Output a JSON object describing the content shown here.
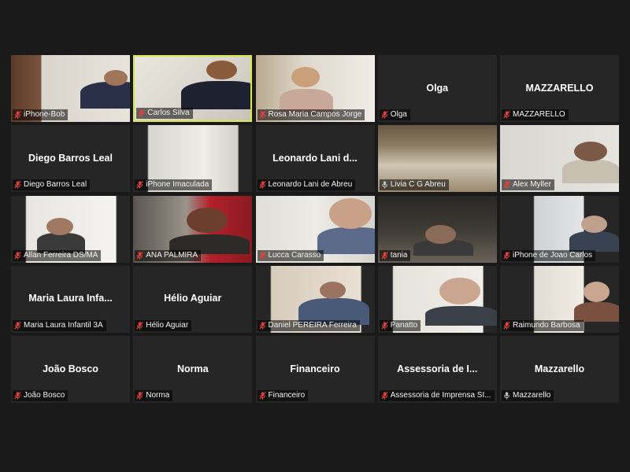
{
  "participants": [
    {
      "name": "iPhone-Bob",
      "label": "iPhone-Bob",
      "video": true,
      "muted": true
    },
    {
      "name": "Carlos Silva",
      "label": "Carlos Silva",
      "video": true,
      "muted": true,
      "active_speaker": true
    },
    {
      "name": "Rosa Maria Campos Jorge",
      "label": "Rosa Maria Campos Jorge",
      "video": true,
      "muted": true
    },
    {
      "name": "Olga",
      "label": "Olga",
      "video": false,
      "muted": true
    },
    {
      "name": "MAZZARELLO",
      "label": "MAZZARELLO",
      "video": false,
      "muted": true
    },
    {
      "name": "Diego Barros Leal",
      "label": "Diego Barros Leal",
      "video": false,
      "muted": true
    },
    {
      "name": "iPhone Imaculada",
      "label": "iPhone Imaculada",
      "video": true,
      "muted": true
    },
    {
      "name": "Leonardo Lani d...",
      "label": "Leonardo Lani de Abreu",
      "video": false,
      "muted": true
    },
    {
      "name": "Livia C G Abreu",
      "label": "Livia C G Abreu",
      "video": true,
      "muted": false
    },
    {
      "name": "Alex Myller",
      "label": "Alex Myller",
      "video": true,
      "muted": true
    },
    {
      "name": "Allan Ferreira DS/MA",
      "label": "Allan Ferreira DS/MA",
      "video": true,
      "muted": true
    },
    {
      "name": "ANA PALMIRA",
      "label": "ANA PALMIRA",
      "video": true,
      "muted": true
    },
    {
      "name": "Lucca Carasso",
      "label": "Lucca Carasso",
      "video": true,
      "muted": true
    },
    {
      "name": "tania",
      "label": "tania",
      "video": true,
      "muted": true
    },
    {
      "name": "iPhone de Joao Carlos",
      "label": "iPhone de Joao Carlos",
      "video": true,
      "muted": true
    },
    {
      "name": "Maria Laura Infa...",
      "label": "Maria Laura Infantil 3A",
      "video": false,
      "muted": true
    },
    {
      "name": "Hélio Aguiar",
      "label": "Hélio Aguiar",
      "video": false,
      "muted": true
    },
    {
      "name": "Daniel PEREIRA Ferreira",
      "label": "Daniel PEREIRA Ferreira",
      "video": true,
      "muted": true
    },
    {
      "name": "Panatto",
      "label": "Panatto",
      "video": true,
      "muted": true
    },
    {
      "name": "Raimundo Barbosa",
      "label": "Raimundo Barbosa",
      "video": true,
      "muted": true
    },
    {
      "name": "João Bosco",
      "label": "João Bosco",
      "video": false,
      "muted": true
    },
    {
      "name": "Norma",
      "label": "Norma",
      "video": false,
      "muted": true
    },
    {
      "name": "Financeiro",
      "label": "Financeiro",
      "video": false,
      "muted": true
    },
    {
      "name": "Assessoria de I...",
      "label": "Assessoria de Imprensa SI...",
      "video": false,
      "muted": true
    },
    {
      "name": "Mazzarello",
      "label": "Mazzarello",
      "video": false,
      "muted": false
    }
  ],
  "colors": {
    "background": "#1a1a1a",
    "tile": "#262626",
    "active_border": "#d7e84a",
    "muted_icon": "#e0403a"
  }
}
